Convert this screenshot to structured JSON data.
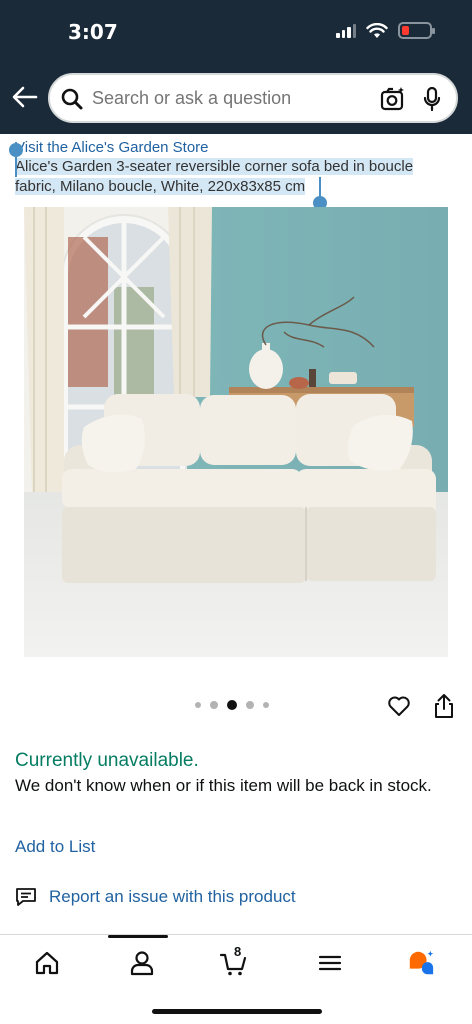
{
  "status_bar": {
    "time": "3:07"
  },
  "search": {
    "placeholder": "Search or ask a question"
  },
  "product": {
    "store_link": "Visit the Alice's Garden Store",
    "title": "Alice's Garden 3-seater reversible corner sofa bed in boucle fabric, Milano boucle, White, 220x83x85 cm",
    "image_count": 5,
    "active_image_index": 2
  },
  "availability": {
    "status": "Currently unavailable.",
    "message": "We don't know when or if this item will be back in stock."
  },
  "actions": {
    "add_to_list": "Add to List",
    "report_issue": "Report an issue with this product"
  },
  "bottom_nav": {
    "items": [
      "home-icon",
      "account-icon",
      "cart-icon",
      "menu-icon",
      "rufus-icon"
    ],
    "cart_count": "8"
  },
  "colors": {
    "header_bg": "#1b2a38",
    "link": "#2162a1",
    "availability": "#067d62",
    "selection": "#d4e7f4",
    "accent_orange": "#ff6a00",
    "accent_blue": "#1a73e8"
  }
}
